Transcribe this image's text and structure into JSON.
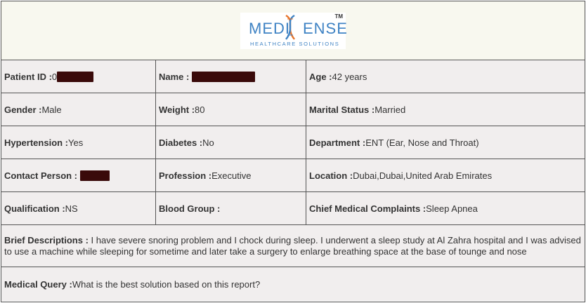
{
  "logo": {
    "word_left": "MEDI",
    "word_right": "ENSE",
    "tm": "TM",
    "tagline": "HEALTHCARE SOLUTIONS"
  },
  "colors": {
    "brand_blue": "#3f83c4",
    "brand_orange": "#e8742a",
    "redaction": "#3a0a0a",
    "row_bg": "#f1eeee"
  },
  "rows": [
    [
      {
        "label": "Patient ID :",
        "value": "0",
        "redacted": true
      },
      {
        "label": "Name : ",
        "value": "",
        "redacted": true
      },
      {
        "label": "Age : ",
        "value": "42 years"
      }
    ],
    [
      {
        "label": "Gender : ",
        "value": "Male"
      },
      {
        "label": "Weight : ",
        "value": "80"
      },
      {
        "label": "Marital Status : ",
        "value": "Married"
      }
    ],
    [
      {
        "label": "Hypertension : ",
        "value": "Yes"
      },
      {
        "label": "Diabetes : ",
        "value": "No"
      },
      {
        "label": "Department : ",
        "value": "ENT (Ear, Nose and Throat)"
      }
    ],
    [
      {
        "label": "Contact Person : ",
        "value": "",
        "redacted": true
      },
      {
        "label": "Profession : ",
        "value": "Executive"
      },
      {
        "label": "Location : ",
        "value": "Dubai,Dubai,United Arab Emirates"
      }
    ],
    [
      {
        "label": "Qualification : ",
        "value": "NS"
      },
      {
        "label": "Blood Group : ",
        "value": ""
      },
      {
        "label": "Chief Medical Complaints : ",
        "value": "Sleep Apnea"
      }
    ]
  ],
  "description": {
    "label": "Brief Descriptions : ",
    "value": "I have severe snoring problem and I chock during sleep. I underwent a sleep study at Al Zahra hospital and I was advised to use a machine while sleeping for sometime and later take a surgery to enlarge breathing space at the base of tounge and nose"
  },
  "query": {
    "label": "Medical Query : ",
    "value": "What is the best solution based on this report?"
  }
}
